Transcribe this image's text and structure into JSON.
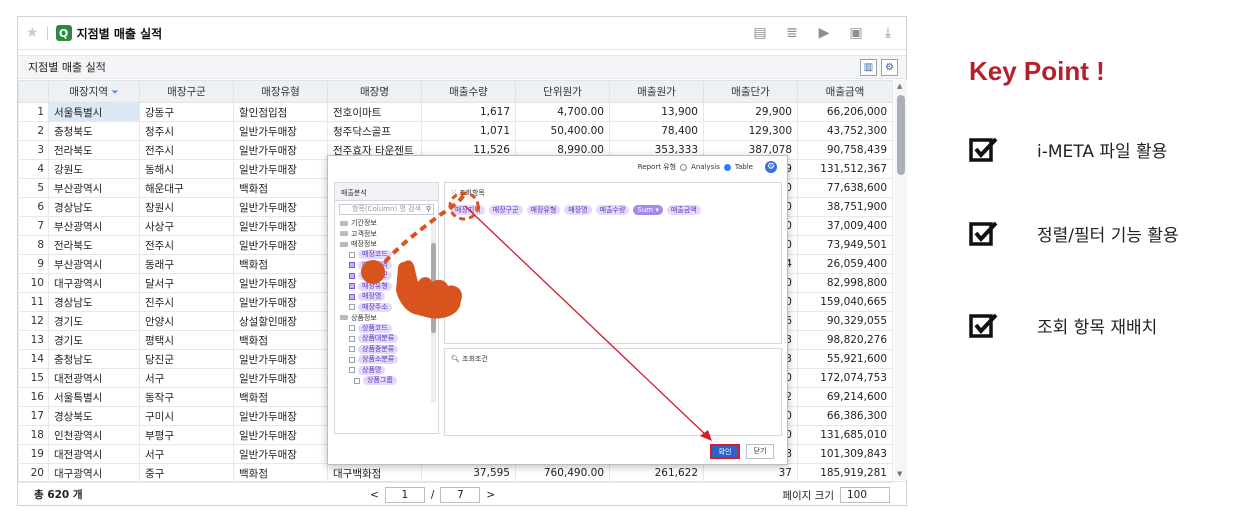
{
  "app": {
    "title": "지점별 매출 실적",
    "subtitle": "지점별 매출 실적"
  },
  "grid": {
    "columns": [
      "매장지역",
      "매장구군",
      "매장유형",
      "매장명",
      "매출수량",
      "단위원가",
      "매출원가",
      "매출단가",
      "매출금액"
    ],
    "rows": [
      [
        "서울특별시",
        "강동구",
        "할인점입점",
        "전호이마트",
        "1,617",
        "4,700.00",
        "13,900",
        "29,900",
        "66,206,000"
      ],
      [
        "충청북도",
        "청주시",
        "일반가두매장",
        "청주닥스골프",
        "1,071",
        "50,400.00",
        "78,400",
        "129,300",
        "43,752,300"
      ],
      [
        "전라북도",
        "전주시",
        "일반가두매장",
        "전주효자 타운젠트",
        "11,526",
        "8,990.00",
        "353,333",
        "387,078",
        "90,758,439"
      ],
      [
        "강원도",
        "동해시",
        "일반가두매장",
        "",
        "",
        "",
        "",
        "",
        "131,512,367"
      ],
      [
        "부산광역시",
        "해운대구",
        "백화점",
        "",
        "",
        "",
        "",
        "",
        "77,638,600"
      ],
      [
        "경상남도",
        "창원시",
        "일반가두매장",
        "",
        "",
        "",
        "",
        "",
        "38,751,900"
      ],
      [
        "부산광역시",
        "사상구",
        "일반가두매장",
        "",
        "",
        "",
        "",
        "",
        "37,009,400"
      ],
      [
        "전라북도",
        "전주시",
        "일반가두매장",
        "",
        "",
        "",
        "",
        "",
        "73,949,501"
      ],
      [
        "부산광역시",
        "동래구",
        "백화점",
        "",
        "",
        "",
        "",
        "",
        "26,059,400"
      ],
      [
        "대구광역시",
        "달서구",
        "일반가두매장",
        "",
        "",
        "",
        "",
        "",
        "82,998,800"
      ],
      [
        "경상남도",
        "진주시",
        "일반가두매장",
        "",
        "",
        "",
        "",
        "",
        "159,040,665"
      ],
      [
        "경기도",
        "안양시",
        "상설할인매장",
        "",
        "",
        "",
        "",
        "",
        "90,329,055"
      ],
      [
        "경기도",
        "평택시",
        "백화점",
        "",
        "",
        "",
        "",
        "",
        "98,820,276"
      ],
      [
        "충청남도",
        "당진군",
        "일반가두매장",
        "",
        "",
        "",
        "",
        "",
        "55,921,600"
      ],
      [
        "대전광역시",
        "서구",
        "일반가두매장",
        "",
        "",
        "",
        "",
        "",
        "172,074,753"
      ],
      [
        "서울특별시",
        "동작구",
        "백화점",
        "",
        "",
        "",
        "",
        "",
        "69,214,600"
      ],
      [
        "경상북도",
        "구미시",
        "일반가두매장",
        "",
        "",
        "",
        "",
        "",
        "66,386,300"
      ],
      [
        "인천광역시",
        "부평구",
        "일반가두매장",
        "",
        "",
        "",
        "",
        "",
        "131,685,010"
      ],
      [
        "대전광역시",
        "서구",
        "일반가두매장",
        "",
        "",
        "",
        "",
        "",
        "101,309,843"
      ],
      [
        "대구광역시",
        "중구",
        "백화점",
        "대구백화점",
        "37,595",
        "760,490.00",
        "261,622",
        "578,674",
        "185,919,281"
      ]
    ],
    "partial_tail": [
      "79",
      "00",
      "00",
      "00",
      "00",
      "04",
      "00",
      "00",
      "56",
      "03",
      "73",
      "00",
      "32",
      "00",
      "00",
      "88",
      "37"
    ]
  },
  "footer": {
    "total": "총  620 개",
    "page": "1",
    "slash": "/",
    "pages": "7",
    "prev": "<",
    "next": ">",
    "page_size_label": "페이지 크기",
    "page_size": "100"
  },
  "dialog": {
    "report_type_label": "Report 유형",
    "analysis": "Analysis",
    "table": "Table",
    "left_header": "매출분석",
    "search_placeholder": "항목(Column) 명 검색",
    "tree": [
      {
        "label": "기간정보",
        "level": 0,
        "type": "folder"
      },
      {
        "label": "고객정보",
        "level": 0,
        "type": "folder"
      },
      {
        "label": "매장정보",
        "level": 0,
        "type": "folder-open"
      },
      {
        "label": "매장코드",
        "level": 1,
        "checked": false
      },
      {
        "label": "매장지역",
        "level": 1,
        "checked": true
      },
      {
        "label": "매장구군",
        "level": 1,
        "checked": true
      },
      {
        "label": "매장유형",
        "level": 1,
        "checked": true
      },
      {
        "label": "매장명",
        "level": 1,
        "checked": true
      },
      {
        "label": "매장주소",
        "level": 1,
        "checked": false
      },
      {
        "label": "상품정보",
        "level": 0,
        "type": "folder-open"
      },
      {
        "label": "상품코드",
        "level": 1,
        "checked": false
      },
      {
        "label": "상품대분류",
        "level": 1,
        "checked": false
      },
      {
        "label": "상품중분류",
        "level": 1,
        "checked": false
      },
      {
        "label": "상품소분류",
        "level": 1,
        "checked": false
      },
      {
        "label": "상품명",
        "level": 1,
        "checked": false
      },
      {
        "label": "상품그룹",
        "level": 2,
        "checked": false
      }
    ],
    "query_items_label": "조회항목",
    "chips": [
      "매장지역",
      "매장구군",
      "매장유형",
      "매장명",
      "매출수량",
      "Sum ▾",
      "매출금액"
    ],
    "conditions_label": "조회조건",
    "ok": "확인",
    "close": "닫기"
  },
  "keypoint": {
    "title": "Key Point !",
    "items": [
      "i-META 파일 활용",
      "정렬/필터 기능 활용",
      "조회 항목 재배치"
    ]
  },
  "colors": {
    "accent": "#b5202e",
    "selection": "#dde8f7",
    "chip": "#e5d9fb",
    "hand": "#d9531e",
    "arrow": "#d21e2a"
  }
}
